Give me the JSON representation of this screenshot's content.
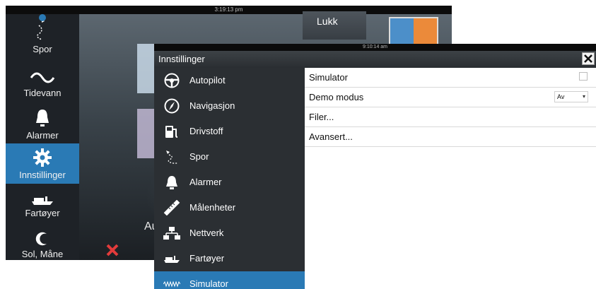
{
  "background": {
    "clock": "3:19:13 pm",
    "close_label": "Lukk",
    "partial_label": "Au",
    "rail": [
      {
        "label": "Spor",
        "icon": "track-icon"
      },
      {
        "label": "Tidevann",
        "icon": "tide-icon"
      },
      {
        "label": "Alarmer",
        "icon": "bell-icon"
      },
      {
        "label": "Innstillinger",
        "icon": "gear-icon",
        "active": true
      },
      {
        "label": "Fartøyer",
        "icon": "vessel-icon"
      },
      {
        "label": "Sol, Måne",
        "icon": "sun-moon-icon"
      }
    ]
  },
  "dialog": {
    "clock": "9:10:14 am",
    "title": "Innstillinger",
    "sidebar": [
      {
        "label": "Autopilot",
        "icon": "steering-wheel-icon"
      },
      {
        "label": "Navigasjon",
        "icon": "compass-icon"
      },
      {
        "label": "Drivstoff",
        "icon": "fuel-icon"
      },
      {
        "label": "Spor",
        "icon": "track-icon"
      },
      {
        "label": "Alarmer",
        "icon": "bell-icon"
      },
      {
        "label": "Målenheter",
        "icon": "ruler-icon"
      },
      {
        "label": "Nettverk",
        "icon": "network-icon"
      },
      {
        "label": "Fartøyer",
        "icon": "vessel-icon"
      },
      {
        "label": "Simulator",
        "icon": "simulator-wave-icon",
        "active": true
      }
    ],
    "settings": {
      "simulator": {
        "label": "Simulator",
        "checked": false
      },
      "demo_mode": {
        "label": "Demo modus",
        "value": "Av"
      },
      "files": {
        "label": "Filer..."
      },
      "advanced": {
        "label": "Avansert..."
      }
    }
  },
  "colors": {
    "accent": "#2a7ab5",
    "sidebar_bg": "#2b2f33",
    "titlebar_bg": "#34393d"
  }
}
